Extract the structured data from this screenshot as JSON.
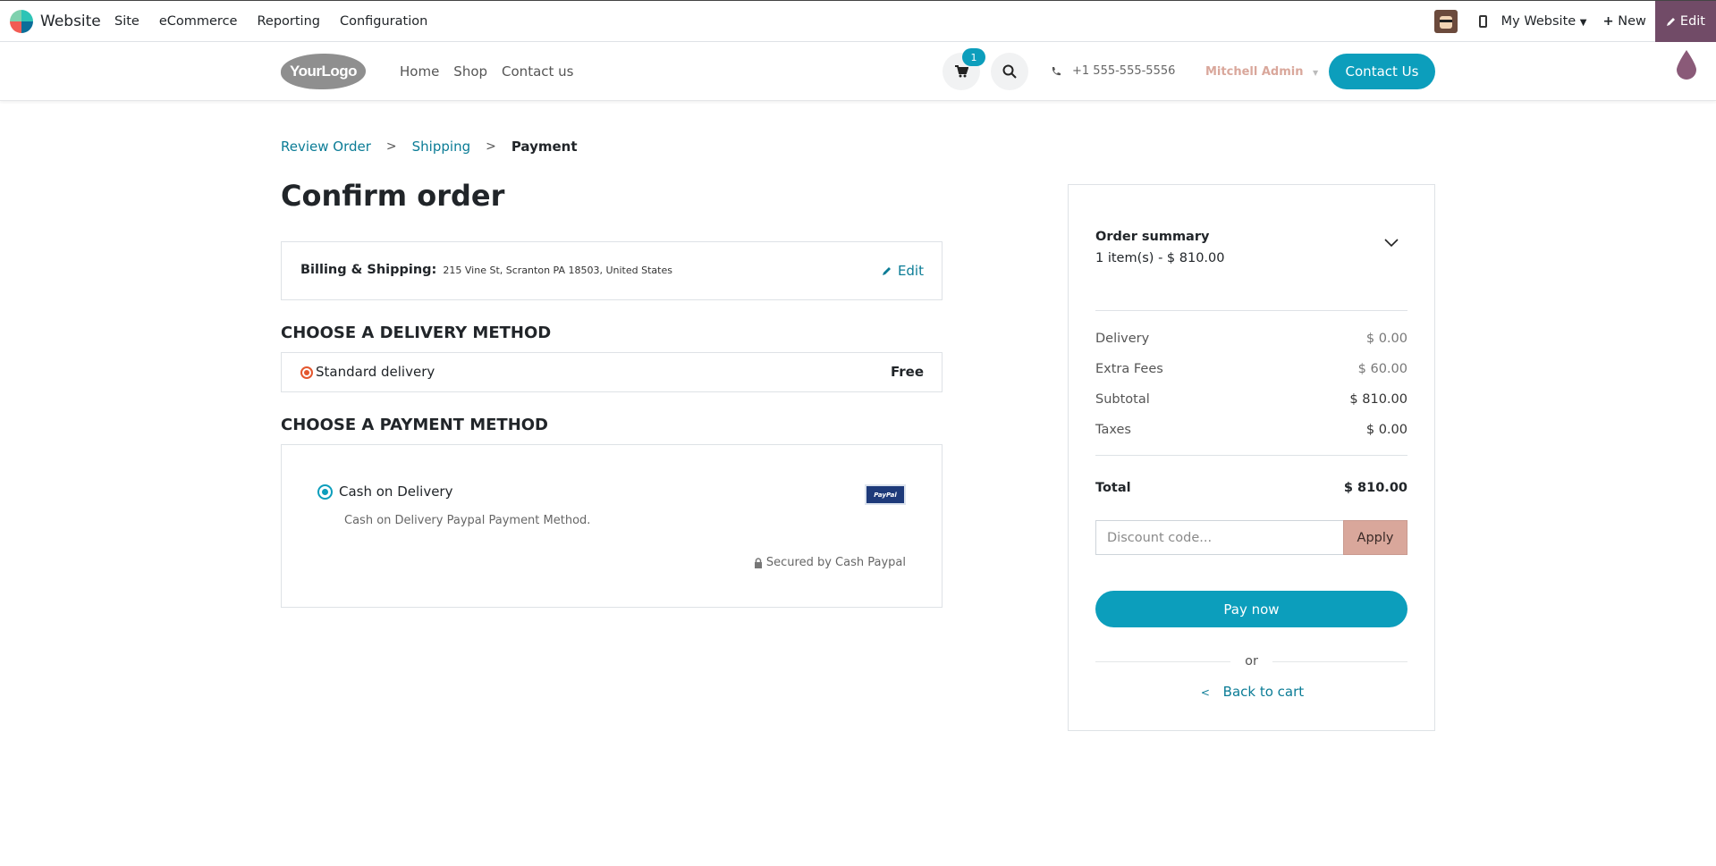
{
  "adminbar": {
    "brand": "Website",
    "menu": [
      "Site",
      "eCommerce",
      "Reporting",
      "Configuration"
    ],
    "my_website": "My Website",
    "new_label": "New",
    "edit_label": "Edit"
  },
  "header": {
    "logo_text": "YourLogo",
    "nav": [
      "Home",
      "Shop",
      "Contact us"
    ],
    "cart_count": "1",
    "phone": "+1 555-555-5556",
    "user": "Mitchell Admin",
    "contact_button": "Contact Us"
  },
  "breadcrumb": {
    "step1": "Review Order",
    "step2": "Shipping",
    "step3": "Payment"
  },
  "page_title": "Confirm order",
  "billing": {
    "label": "Billing & Shipping:",
    "address": "215 Vine St, Scranton PA 18503, United States",
    "edit_label": "Edit"
  },
  "delivery": {
    "section_title": "CHOOSE A DELIVERY METHOD",
    "method": "Standard delivery",
    "price": "Free"
  },
  "payment": {
    "section_title": "CHOOSE A PAYMENT METHOD",
    "method": "Cash on Delivery",
    "description": "Cash on Delivery Paypal Payment Method.",
    "logo_text": "PayPal",
    "secured": "Secured by Cash Paypal"
  },
  "summary": {
    "title": "Order summary",
    "subtitle": "1 item(s) -  $ 810.00",
    "delivery_label": "Delivery",
    "delivery_value": "$ 0.00",
    "fees_label": "Extra Fees",
    "fees_value": "$ 60.00",
    "subtotal_label": "Subtotal",
    "subtotal_value": "$ 810.00",
    "taxes_label": "Taxes",
    "taxes_value": "$ 0.00",
    "total_label": "Total",
    "total_value": "$ 810.00",
    "discount_placeholder": "Discount code...",
    "apply_label": "Apply",
    "pay_label": "Pay now",
    "or_label": "or",
    "back_label": "Back to cart"
  },
  "colors": {
    "primary": "#0c9ebc",
    "link": "#0b7c96",
    "admin_edit": "#714b67",
    "secondary_btn": "#d9a79b",
    "radio_delivery": "#e4572e"
  }
}
